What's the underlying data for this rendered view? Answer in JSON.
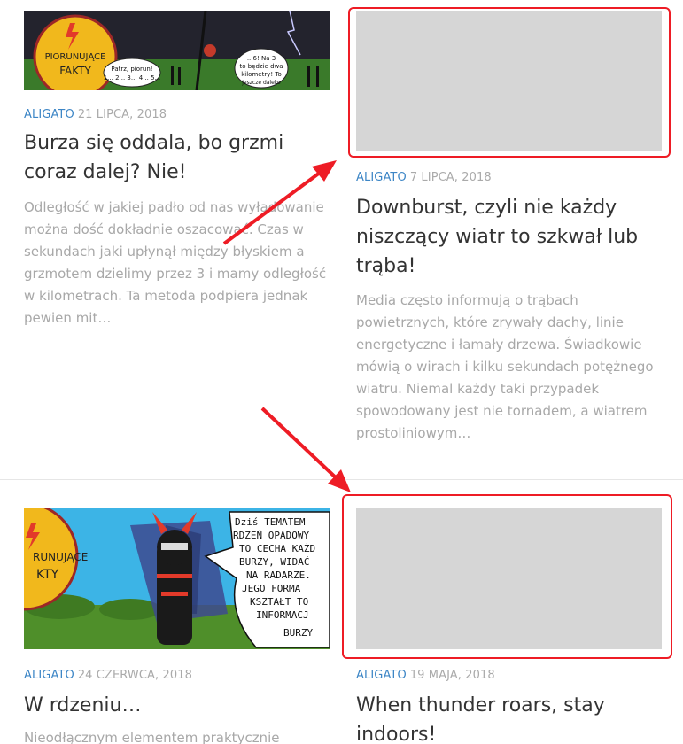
{
  "posts": [
    {
      "author": "ALIGATO",
      "date": "21 LIPCA, 2018",
      "title": "Burza się oddala, bo grzmi coraz dalej? Nie!",
      "excerpt": "Odległość w jakiej padło od nas wyładowanie można dość dokładnie oszacować. Czas w sekundach jaki upłynął między błyskiem a grzmotem dzielimy przez 3 i mamy odległość w kilometrach. Ta metoda podpiera jednak pewien mit…",
      "comic": {
        "badge_line1": "PIORUNUJĄCE",
        "badge_line2": "FAKTY",
        "bubble1": "Patrz, piorun! 1... 2... 3... 4... 5...",
        "bubble2": "...6! Na 3 to będzie dwa kilometry! To jeszcze daleko"
      }
    },
    {
      "author": "ALIGATO",
      "date": "7 LIPCA, 2018",
      "title": "Downburst, czyli nie każdy niszczący wiatr to szkwał lub trąba!",
      "excerpt": "Media często informują o trąbach powietrznych, które zrywały dachy, linie energetyczne i łamały drzewa. Świadkowie mówią o wirach i kilku sekundach potężnego wiatru. Niemal każdy taki przypadek spowodowany jest nie tornadem, a wiatrem prostoliniowym…"
    },
    {
      "author": "ALIGATO",
      "date": "24 CZERWCA, 2018",
      "title": "W rdzeniu…",
      "excerpt": "Nieodłącznym elementem praktycznie",
      "comic": {
        "badge_line1": "RUNUJĄCE",
        "badge_line2": "KTY",
        "speech": "Dziś TEMATEM RDZEŃ OPADOWY TO CECHA KAŻD BURZY, WIDAĆ NA RADARZE. JEGO FORMA KSZTAŁT TO INFORMACJ BURZY"
      }
    },
    {
      "author": "ALIGATO",
      "date": "19 MAJA, 2018",
      "title": "When thunder roars, stay indoors!"
    }
  ],
  "annotation_color": "#ee1c25",
  "placeholder_color": "#d6d6d6",
  "author_color": "#3d86c6"
}
